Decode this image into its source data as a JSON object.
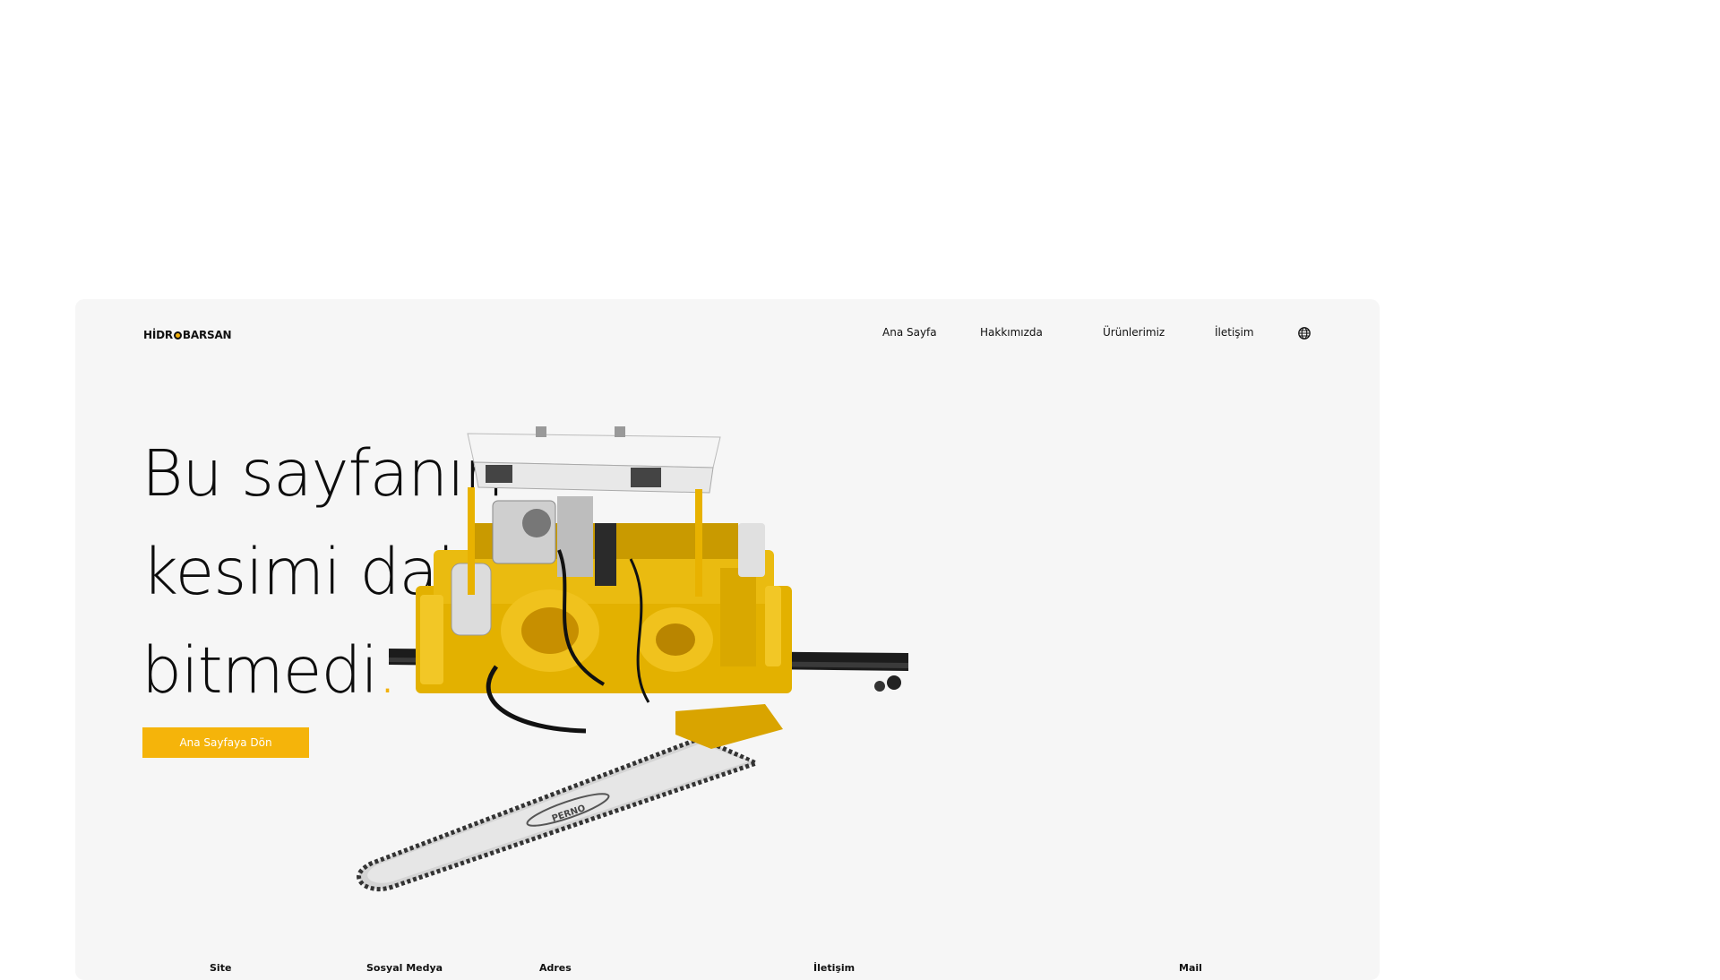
{
  "brand": {
    "logo_text_before": "HİDR",
    "logo_text_after": "BARSAN",
    "accent_color": "#f5b40a",
    "card_background": "#f6f6f6"
  },
  "nav": {
    "items": [
      {
        "label": "Ana Sayfa"
      },
      {
        "label": "Hakkımızda"
      },
      {
        "label": "Ürünlerimiz"
      },
      {
        "label": "İletişim"
      }
    ],
    "language_icon": "globe-icon"
  },
  "hero": {
    "line1": "Bu sayfanın",
    "line2": "kesimi daha",
    "line3": "bitmedi",
    "accent_dot": ".",
    "button_label": "Ana Sayfaya Dön"
  },
  "product_image": {
    "chain_brand": "PERNO"
  },
  "footer": {
    "columns": [
      {
        "label": "Site"
      },
      {
        "label": "Sosyal Medya"
      },
      {
        "label": "Adres"
      },
      {
        "label": "İletişim"
      },
      {
        "label": "Mail"
      }
    ]
  }
}
